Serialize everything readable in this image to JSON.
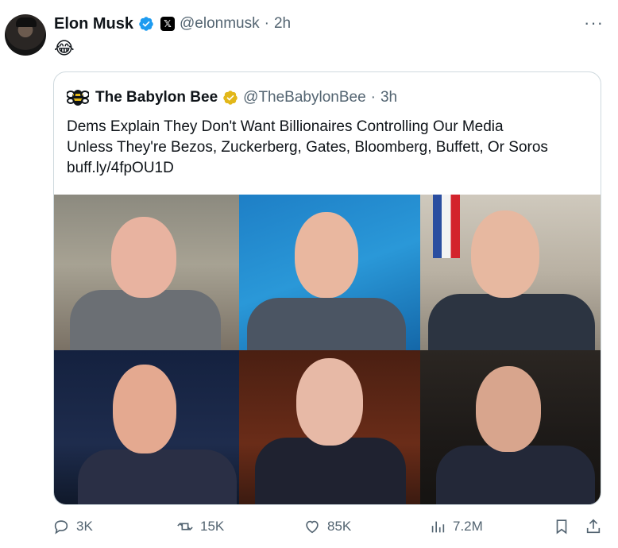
{
  "post": {
    "author_name": "Elon Musk",
    "handle": "@elonmusk",
    "separator": "·",
    "time": "2h",
    "text": "😂",
    "more": "···"
  },
  "quote": {
    "author_name": "The Babylon Bee",
    "handle": "@TheBabylonBee",
    "separator": "·",
    "time": "3h",
    "text_line1": "Dems Explain They Don't Want Billionaires Controlling Our Media",
    "text_line2": "Unless They're Bezos, Zuckerberg, Gates, Bloomberg, Buffett, Or Soros",
    "link": "buff.ly/4fpOU1D"
  },
  "actions": {
    "replies": "3K",
    "reposts": "15K",
    "likes": "85K",
    "views": "7.2M"
  },
  "colors": {
    "verified_blue": "#1d9bf0",
    "verified_gold": "#e2b719",
    "muted": "#536471",
    "border": "#cfd9de"
  }
}
